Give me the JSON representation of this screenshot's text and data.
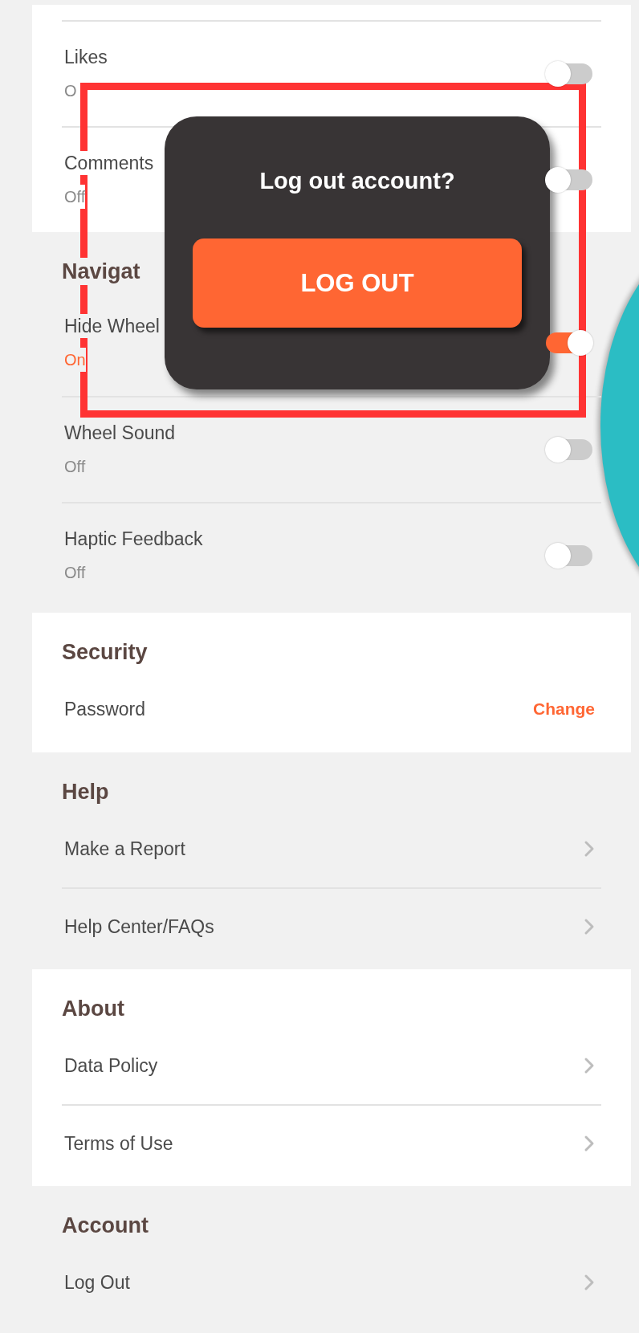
{
  "sections": [
    {
      "kind": "card",
      "rows": [
        {
          "kind": "toggle",
          "label": "Likes",
          "status": "O",
          "on": false
        },
        {
          "kind": "toggle",
          "label": "Comments",
          "status": "Off",
          "on": false
        }
      ]
    },
    {
      "kind": "plain",
      "title": "Navigat",
      "rows": [
        {
          "kind": "toggle",
          "label": "Hide Wheel",
          "status": "On",
          "on": true
        },
        {
          "kind": "toggle",
          "label": "Wheel Sound",
          "status": "Off",
          "on": false
        },
        {
          "kind": "toggle",
          "label": "Haptic Feedback",
          "status": "Off",
          "on": false
        }
      ]
    },
    {
      "kind": "card",
      "title": "Security",
      "rows": [
        {
          "kind": "action",
          "label": "Password",
          "action": "Change"
        }
      ]
    },
    {
      "kind": "plain",
      "title": "Help",
      "rows": [
        {
          "kind": "link",
          "label": "Make a Report"
        },
        {
          "kind": "link",
          "label": "Help Center/FAQs"
        }
      ]
    },
    {
      "kind": "card",
      "title": "About",
      "rows": [
        {
          "kind": "link",
          "label": "Data Policy"
        },
        {
          "kind": "link",
          "label": "Terms of Use"
        }
      ]
    },
    {
      "kind": "plain",
      "title": "Account",
      "rows": [
        {
          "kind": "link",
          "label": "Log Out"
        }
      ]
    }
  ],
  "dialog": {
    "title": "Log out account?",
    "button": "LOG OUT"
  }
}
